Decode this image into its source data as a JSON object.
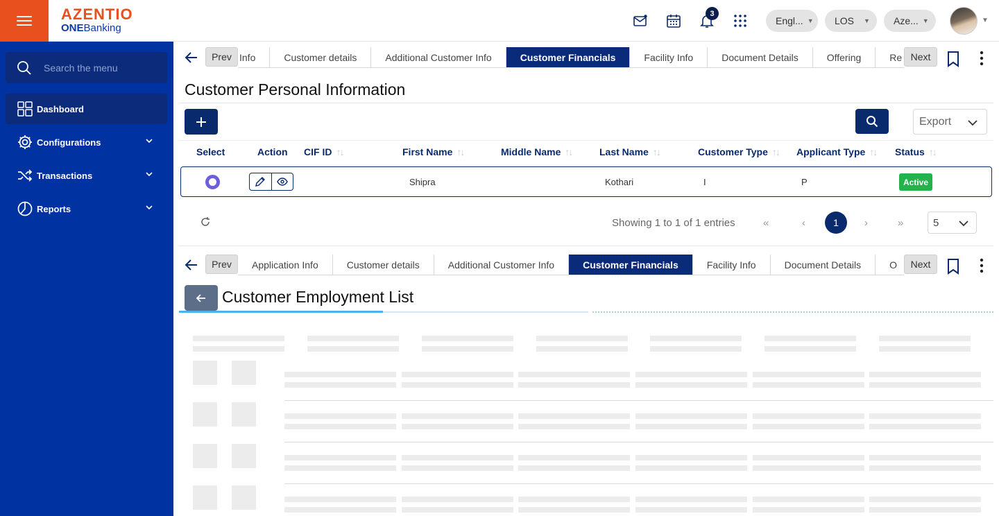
{
  "app": {
    "logo_main": "AZENTIO",
    "logo_sub_bold": "ONE",
    "logo_sub_rest": "Banking"
  },
  "header": {
    "notification_count": "3",
    "language": "Engl...",
    "module": "LOS",
    "entity": "Aze...",
    "icons": [
      "mail-icon",
      "calendar-icon",
      "bell-icon",
      "apps-grid-icon"
    ]
  },
  "sidebar": {
    "search_placeholder": "Search the menu",
    "items": [
      {
        "label": "Dashboard",
        "icon": "dashboard-icon",
        "active": true
      },
      {
        "label": "Configurations",
        "icon": "gear-icon",
        "expandable": true
      },
      {
        "label": "Transactions",
        "icon": "shuffle-icon",
        "expandable": true
      },
      {
        "label": "Reports",
        "icon": "pie-chart-icon",
        "expandable": true
      }
    ]
  },
  "tabs_top": {
    "prev": "Prev",
    "next": "Next",
    "items": [
      "Info",
      "Customer details",
      "Additional Customer Info",
      "Customer Financials",
      "Facility Info",
      "Document Details",
      "Offering",
      "Re"
    ],
    "active": "Customer Financials"
  },
  "personal_info": {
    "title": "Customer Personal Information",
    "export_label": "Export",
    "columns": [
      "Select",
      "Action",
      "CIF ID",
      "First Name",
      "Middle Name",
      "Last Name",
      "Customer Type",
      "Applicant Type",
      "Status"
    ],
    "rows": [
      {
        "cif_id": "",
        "first_name": "Shipra",
        "middle_name": "",
        "last_name": "Kothari",
        "customer_type": "I",
        "applicant_type": "P",
        "status": "Active"
      }
    ],
    "pagination": {
      "info": "Showing 1 to 1 of 1 entries",
      "current_page": "1",
      "page_size": "5"
    }
  },
  "tabs_bottom": {
    "prev": "Prev",
    "next": "Next",
    "items": [
      "Application Info",
      "Customer details",
      "Additional Customer Info",
      "Customer Financials",
      "Facility Info",
      "Document Details",
      "O"
    ],
    "active": "Customer Financials"
  },
  "employment": {
    "title": "Customer Employment List"
  },
  "colors": {
    "brand_orange": "#e8501d",
    "sidebar_blue": "#0033a1",
    "navy": "#0a2a6e",
    "active_tab": "#0a2a7a",
    "status_green": "#24b24b",
    "radio_purple": "#6b5fdc"
  }
}
